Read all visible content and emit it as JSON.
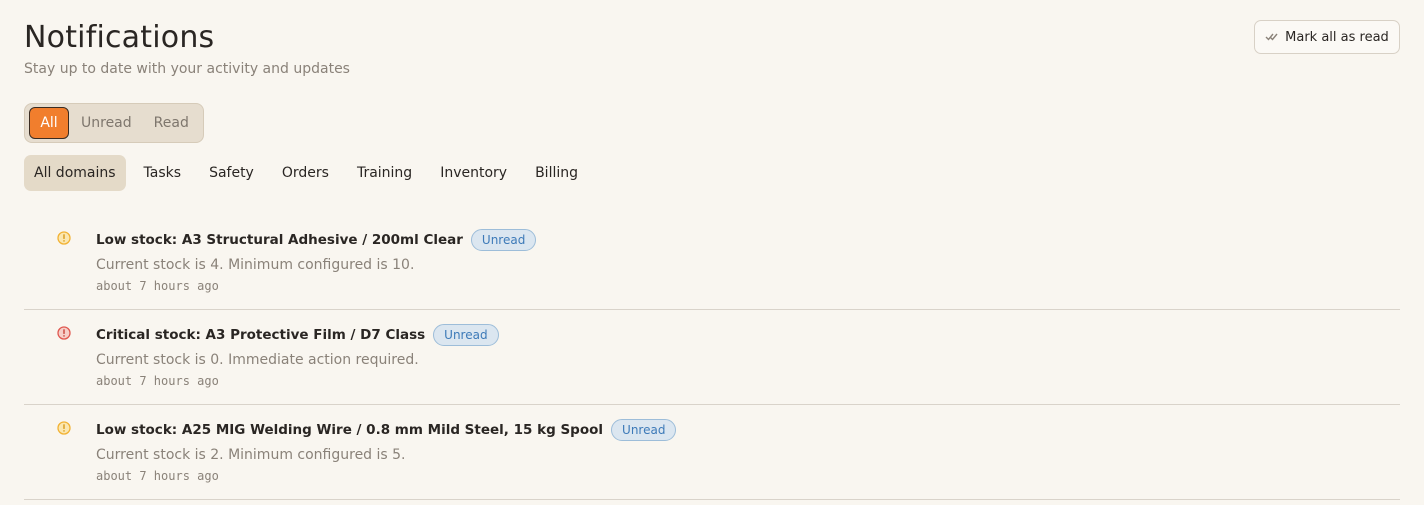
{
  "header": {
    "title": "Notifications",
    "subtitle": "Stay up to date with your activity and updates",
    "mark_all_label": "Mark all as read"
  },
  "read_filter": {
    "options": [
      "All",
      "Unread",
      "Read"
    ],
    "selected": "All"
  },
  "domain_filter": {
    "options": [
      "All domains",
      "Tasks",
      "Safety",
      "Orders",
      "Training",
      "Inventory",
      "Billing"
    ],
    "selected": "All domains"
  },
  "colors": {
    "accent": "#f17e2d",
    "warning": "#f2b233",
    "critical": "#e0574f",
    "badge": "#3d7ab8"
  },
  "notifications": [
    {
      "severity": "warning",
      "icon": "warning-circle-icon",
      "title": "Low stock: A3 Structural Adhesive / 200ml Clear",
      "badge": "Unread",
      "message": "Current stock is 4. Minimum configured is 10.",
      "time": "about 7 hours ago"
    },
    {
      "severity": "critical",
      "icon": "critical-circle-icon",
      "title": "Critical stock: A3 Protective Film / D7 Class",
      "badge": "Unread",
      "message": "Current stock is 0. Immediate action required.",
      "time": "about 7 hours ago"
    },
    {
      "severity": "warning",
      "icon": "warning-circle-icon",
      "title": "Low stock: A25 MIG Welding Wire / 0.8 mm Mild Steel, 15 kg Spool",
      "badge": "Unread",
      "message": "Current stock is 2. Minimum configured is 5.",
      "time": "about 7 hours ago"
    }
  ]
}
